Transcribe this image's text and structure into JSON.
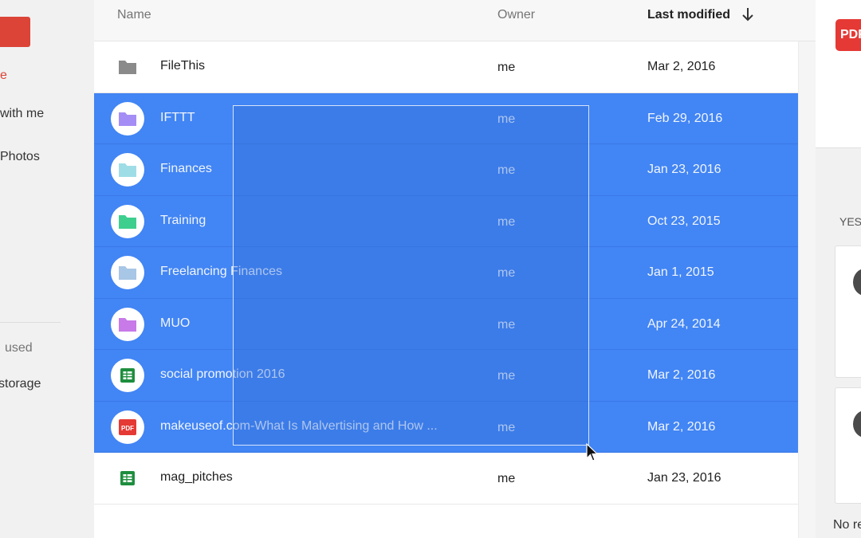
{
  "sidebar": {
    "active_item": "e",
    "shared_item": "with me",
    "photos_item": "Photos",
    "used_label": "used",
    "storage_item": "storage"
  },
  "table": {
    "headers": {
      "name": "Name",
      "owner": "Owner",
      "modified": "Last modified"
    },
    "sort_direction": "descending",
    "rows": [
      {
        "name": "FileThis",
        "owner": "me",
        "modified": "Mar 2, 2016",
        "type": "folder",
        "icon": "folder-icon",
        "color": "#8a8a8a",
        "selected": false
      },
      {
        "name": "IFTTT",
        "owner": "me",
        "modified": "Feb 29, 2016",
        "type": "folder",
        "icon": "folder-icon",
        "color": "#a48ef5",
        "selected": true
      },
      {
        "name": "Finances",
        "owner": "me",
        "modified": "Jan 23, 2016",
        "type": "folder",
        "icon": "folder-icon",
        "color": "#9fdde6",
        "selected": true
      },
      {
        "name": "Training",
        "owner": "me",
        "modified": "Oct 23, 2015",
        "type": "folder",
        "icon": "folder-icon",
        "color": "#3ecf8e",
        "selected": true
      },
      {
        "name": "Freelancing Finances",
        "owner": "me",
        "modified": "Jan 1, 2015",
        "type": "folder",
        "icon": "folder-icon",
        "color": "#a8c6e5",
        "selected": true
      },
      {
        "name": "MUO",
        "owner": "me",
        "modified": "Apr 24, 2014",
        "type": "folder",
        "icon": "folder-icon",
        "color": "#c77ae8",
        "selected": true
      },
      {
        "name": "social promotion 2016",
        "owner": "me",
        "modified": "Mar 2, 2016",
        "type": "sheet",
        "icon": "spreadsheet-icon",
        "color": "#1e8e3e",
        "selected": true
      },
      {
        "name": "makeuseof.com-What Is Malvertising and How ...",
        "owner": "me",
        "modified": "Mar 2, 2016",
        "type": "pdf",
        "icon": "pdf-icon",
        "color": "#e53935",
        "selected": true
      },
      {
        "name": "mag_pitches",
        "owner": "me",
        "modified": "Jan 23, 2016",
        "type": "sheet",
        "icon": "spreadsheet-icon",
        "color": "#1e8e3e",
        "selected": false
      }
    ]
  },
  "details": {
    "pdf_badge": "PDF",
    "yes_label": "YES",
    "footer_text": "No re"
  },
  "colors": {
    "selection": "#4285f4",
    "accent": "#db4437"
  }
}
